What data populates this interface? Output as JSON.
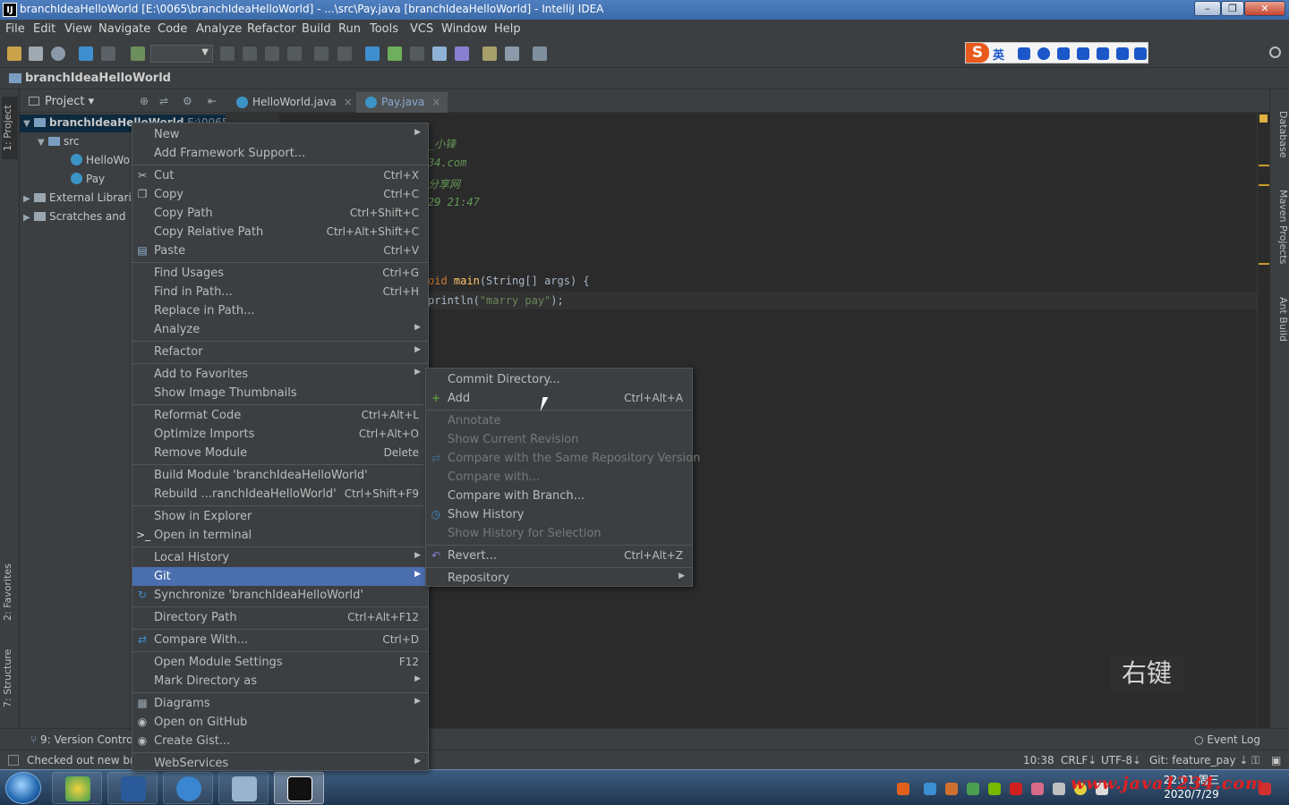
{
  "window": {
    "title": "branchIdeaHelloWorld [E:\\0065\\branchIdeaHelloWorld] - ...\\src\\Pay.java [branchIdeaHelloWorld] - IntelliJ IDEA",
    "app_icon": "IJ"
  },
  "menubar": [
    "File",
    "Edit",
    "View",
    "Navigate",
    "Code",
    "Analyze",
    "Refactor",
    "Build",
    "Run",
    "Tools",
    "VCS",
    "Window",
    "Help"
  ],
  "ime": {
    "logo": "S",
    "mode": "英"
  },
  "navbar": {
    "project": "branchIdeaHelloWorld"
  },
  "left_strip": {
    "project": "1: Project",
    "favorites": "2: Favorites",
    "structure": "7: Structure"
  },
  "right_strip": {
    "database": "Database",
    "maven": "Maven Projects",
    "ant": "Ant Build"
  },
  "project_panel": {
    "title": "Project",
    "tree": [
      {
        "label": "branchIdeaHelloWorld",
        "extra": "E:\\0065\\"
      },
      {
        "label": "src"
      },
      {
        "label": "HelloWo"
      },
      {
        "label": "Pay"
      },
      {
        "label": "External Librari"
      },
      {
        "label": "Scratches and"
      }
    ]
  },
  "tabs": [
    {
      "label": "HelloWorld.java"
    },
    {
      "label": "Pay.java"
    }
  ],
  "code": {
    "line1": "_小锋",
    "line2": "34.com",
    "line3": "分享网",
    "line4": "29 21:47",
    "line5_kw": "oid",
    "line5_fn": "main",
    "line5_rest": "(String[] args) {",
    "line6_pre": "println(",
    "line6_str": "\"marry pay\"",
    "line6_post": ");"
  },
  "hint": "右键",
  "context_menu": [
    {
      "label": "New",
      "shortcut": "",
      "submenu": true,
      "icon": ""
    },
    {
      "label": "Add Framework Support...",
      "shortcut": ""
    },
    {
      "sep": true
    },
    {
      "label": "Cut",
      "shortcut": "Ctrl+X",
      "icon": "scissors-icon"
    },
    {
      "label": "Copy",
      "shortcut": "Ctrl+C",
      "icon": "copy-icon"
    },
    {
      "label": "Copy Path",
      "shortcut": "Ctrl+Shift+C"
    },
    {
      "label": "Copy Relative Path",
      "shortcut": "Ctrl+Alt+Shift+C"
    },
    {
      "label": "Paste",
      "shortcut": "Ctrl+V",
      "icon": "paste-icon"
    },
    {
      "sep": true
    },
    {
      "label": "Find Usages",
      "shortcut": "Ctrl+G"
    },
    {
      "label": "Find in Path...",
      "shortcut": "Ctrl+H"
    },
    {
      "label": "Replace in Path...",
      "shortcut": ""
    },
    {
      "label": "Analyze",
      "shortcut": "",
      "submenu": true
    },
    {
      "sep": true
    },
    {
      "label": "Refactor",
      "shortcut": "",
      "submenu": true
    },
    {
      "sep": true
    },
    {
      "label": "Add to Favorites",
      "shortcut": "",
      "submenu": true
    },
    {
      "label": "Show Image Thumbnails",
      "shortcut": ""
    },
    {
      "sep": true
    },
    {
      "label": "Reformat Code",
      "shortcut": "Ctrl+Alt+L"
    },
    {
      "label": "Optimize Imports",
      "shortcut": "Ctrl+Alt+O"
    },
    {
      "label": "Remove Module",
      "shortcut": "Delete"
    },
    {
      "sep": true
    },
    {
      "label": "Build Module 'branchIdeaHelloWorld'",
      "shortcut": ""
    },
    {
      "label": "Rebuild ...ranchIdeaHelloWorld'",
      "shortcut": "Ctrl+Shift+F9"
    },
    {
      "sep": true
    },
    {
      "label": "Show in Explorer",
      "shortcut": ""
    },
    {
      "label": "Open in terminal",
      "shortcut": "",
      "icon": "terminal-icon"
    },
    {
      "sep": true
    },
    {
      "label": "Local History",
      "shortcut": "",
      "submenu": true
    },
    {
      "label": "Git",
      "shortcut": "",
      "submenu": true,
      "highlight": true
    },
    {
      "label": "Synchronize 'branchIdeaHelloWorld'",
      "shortcut": "",
      "icon": "sync-icon"
    },
    {
      "sep": true
    },
    {
      "label": "Directory Path",
      "shortcut": "Ctrl+Alt+F12"
    },
    {
      "sep": true
    },
    {
      "label": "Compare With...",
      "shortcut": "Ctrl+D",
      "icon": "compare-icon"
    },
    {
      "sep": true
    },
    {
      "label": "Open Module Settings",
      "shortcut": "F12"
    },
    {
      "label": "Mark Directory as",
      "shortcut": "",
      "submenu": true
    },
    {
      "sep": true
    },
    {
      "label": "Diagrams",
      "shortcut": "",
      "submenu": true,
      "icon": "diagram-icon"
    },
    {
      "label": "Open on GitHub",
      "shortcut": "",
      "icon": "github-icon"
    },
    {
      "label": "Create Gist...",
      "shortcut": "",
      "icon": "github-icon"
    },
    {
      "sep": true
    },
    {
      "label": "WebServices",
      "shortcut": "",
      "submenu": true
    }
  ],
  "git_submenu": [
    {
      "label": "Commit Directory...",
      "shortcut": ""
    },
    {
      "label": "Add",
      "shortcut": "Ctrl+Alt+A",
      "icon": "plus-icon"
    },
    {
      "sep": true
    },
    {
      "label": "Annotate",
      "shortcut": "",
      "disabled": true
    },
    {
      "label": "Show Current Revision",
      "shortcut": "",
      "disabled": true
    },
    {
      "label": "Compare with the Same Repository Version",
      "shortcut": "",
      "disabled": true,
      "icon": "compare-icon"
    },
    {
      "label": "Compare with...",
      "shortcut": "",
      "disabled": true
    },
    {
      "label": "Compare with Branch...",
      "shortcut": ""
    },
    {
      "label": "Show History",
      "shortcut": "",
      "icon": "history-icon"
    },
    {
      "label": "Show History for Selection",
      "shortcut": "",
      "disabled": true
    },
    {
      "sep": true
    },
    {
      "label": "Revert...",
      "shortcut": "Ctrl+Alt+Z",
      "icon": "revert-icon"
    },
    {
      "sep": true
    },
    {
      "label": "Repository",
      "shortcut": "",
      "submenu": true
    }
  ],
  "bottom": {
    "version_control": "9: Version Control",
    "event_log": "Event Log",
    "status_msg": "Checked out new br",
    "position": "10:38",
    "line_sep": "CRLF⇣",
    "encoding": "UTF-8⇣",
    "git": "Git: feature_pay ⇣"
  },
  "taskbar": {
    "time": "22:01 周三",
    "date": "2020/7/29",
    "watermark": "www.java1234.com"
  },
  "colors": {
    "highlight": "#4b6eaf",
    "menu_bg": "#3c3f41",
    "editor_bg": "#2b2b2b"
  }
}
